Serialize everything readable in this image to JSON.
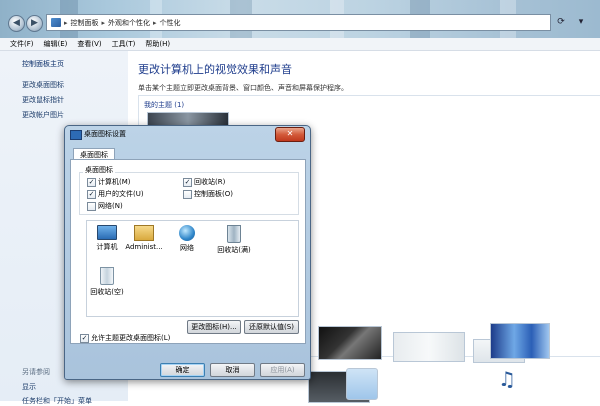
{
  "address": {
    "segments": [
      "控制面板",
      "外观和个性化",
      "个性化"
    ]
  },
  "menu": [
    "文件(F)",
    "编辑(E)",
    "查看(V)",
    "工具(T)",
    "帮助(H)"
  ],
  "left_nav": {
    "home": "控制面板主页",
    "links": [
      "更改桌面图标",
      "更改鼠标指针",
      "更改帐户图片"
    ],
    "see_also": "另请参阅",
    "see_also_links": [
      "显示",
      "任务栏和「开始」菜单"
    ]
  },
  "main": {
    "heading": "更改计算机上的视觉效果和声音",
    "subtitle": "单击某个主题立即更改桌面背景、窗口颜色、声音和屏幕保护程序。",
    "my_themes": "我的主题 (1)"
  },
  "dialog": {
    "title": "桌面图标设置",
    "close": "✕",
    "tab": "桌面图标",
    "group_label": "桌面图标",
    "checkboxes": [
      {
        "label": "计算机(M)",
        "checked": true
      },
      {
        "label": "回收站(R)",
        "checked": true
      },
      {
        "label": "用户的文件(U)",
        "checked": true
      },
      {
        "label": "控制面板(O)",
        "checked": false
      },
      {
        "label": "网络(N)",
        "checked": false
      }
    ],
    "icons": [
      "计算机",
      "Administ...",
      "网络",
      "回收站(满)",
      "回收站(空)"
    ],
    "change_icon_button": "更改图标(H)...",
    "restore_default_button": "还原默认值(S)",
    "allow_themes_label": "允许主题更改桌面图标(L)",
    "allow_themes_checked": true,
    "ok_button": "确定",
    "cancel_button": "取消",
    "apply_button": "应用(A)"
  },
  "colors": {
    "heading": "#1e3c8c",
    "link": "#1a3a68",
    "close_button": "#c0391d"
  }
}
